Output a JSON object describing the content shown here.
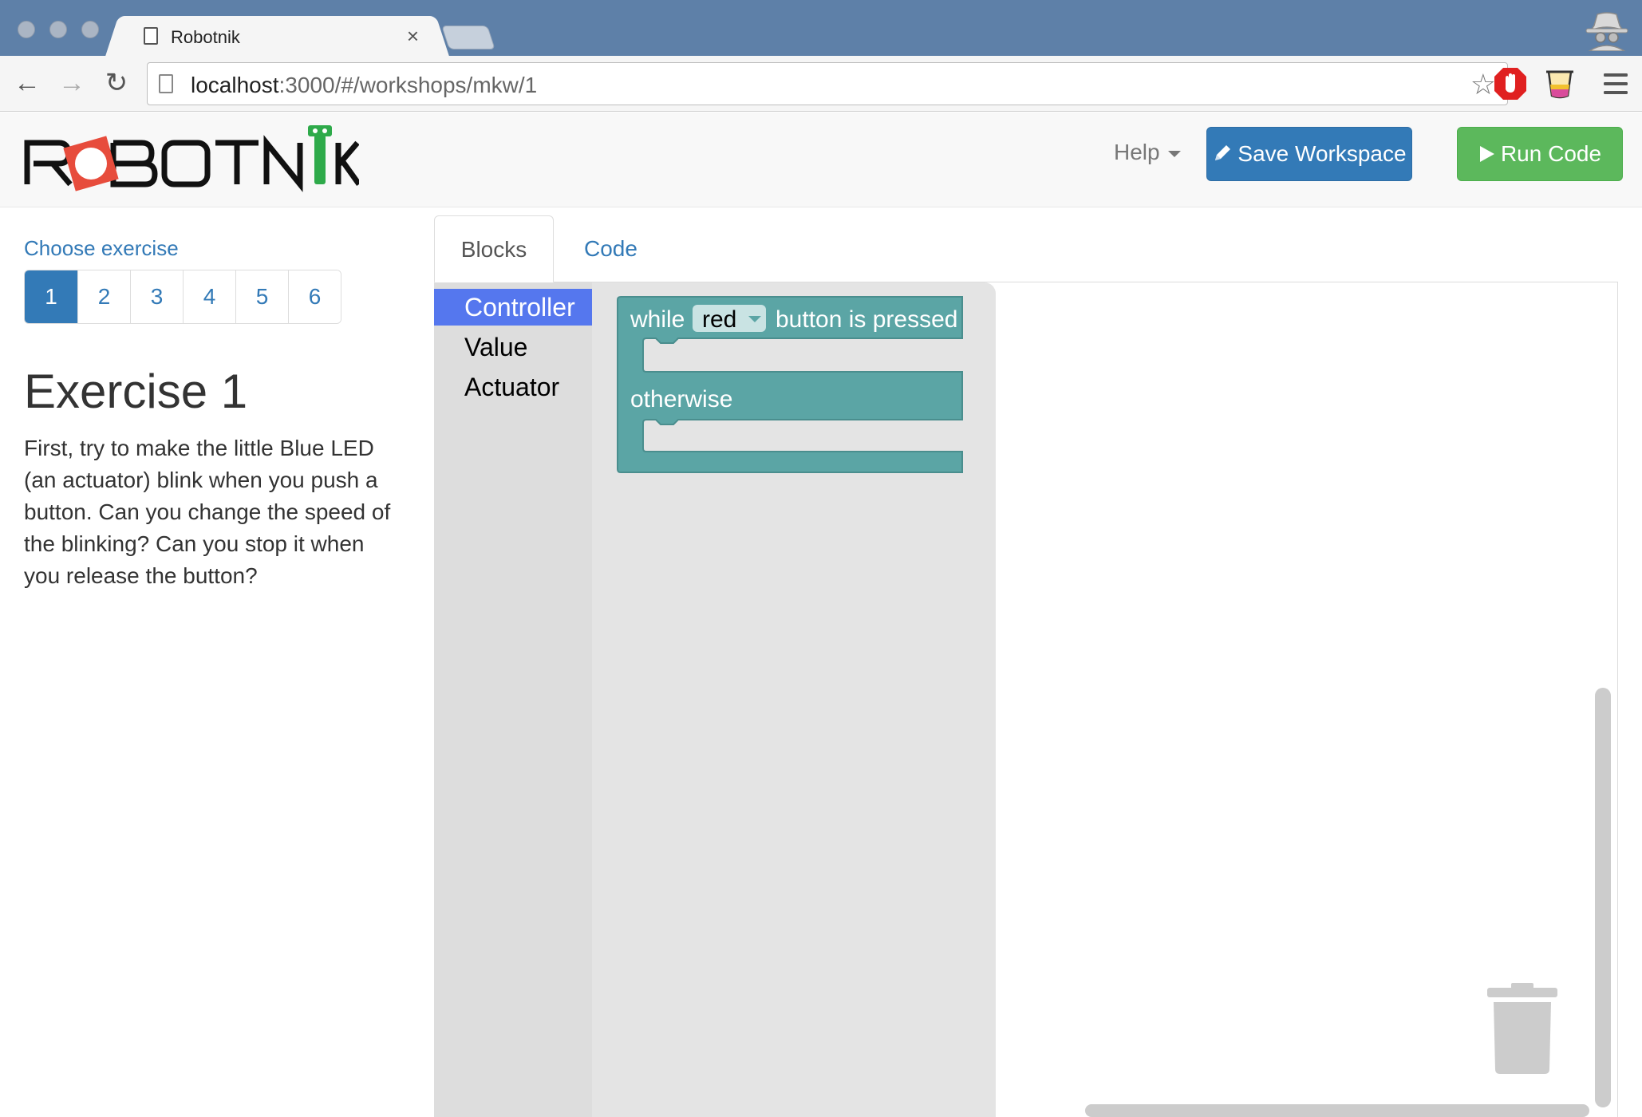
{
  "browser": {
    "tab_title": "Robotnik",
    "tab_close": "×",
    "url_host": "localhost",
    "url_rest": ":3000/#/workshops/mkw/1",
    "back_glyph": "←",
    "forward_glyph": "→",
    "reload_glyph": "↻",
    "star_glyph": "☆"
  },
  "navbar": {
    "logo_alt": "ROBOTNIK",
    "help_label": "Help",
    "save_label": "Save Workspace",
    "save_icon": "pencil-icon",
    "run_label": "Run Code",
    "run_icon": "play-icon",
    "save_color": "#337ab7",
    "run_color": "#5cb85c"
  },
  "sidebar": {
    "choose_label": "Choose exercise",
    "exercises": [
      "1",
      "2",
      "3",
      "4",
      "5",
      "6"
    ],
    "active_exercise": "1",
    "title": "Exercise 1",
    "description": "First, try to make the little Blue LED (an actuator) blink when you push a button. Can you change the speed of the blinking? Can you stop it when you release the button?"
  },
  "tabs": {
    "blocks": "Blocks",
    "code": "Code",
    "active": "Blocks"
  },
  "toolbox": {
    "categories": [
      "Controller",
      "Value",
      "Actuator"
    ],
    "selected": "Controller",
    "selected_color": "#5577ee"
  },
  "block": {
    "while_text": "while",
    "dropdown_value": "red",
    "tail_text": "button is pressed",
    "otherwise_text": "otherwise",
    "color": "#5ba5a5"
  }
}
